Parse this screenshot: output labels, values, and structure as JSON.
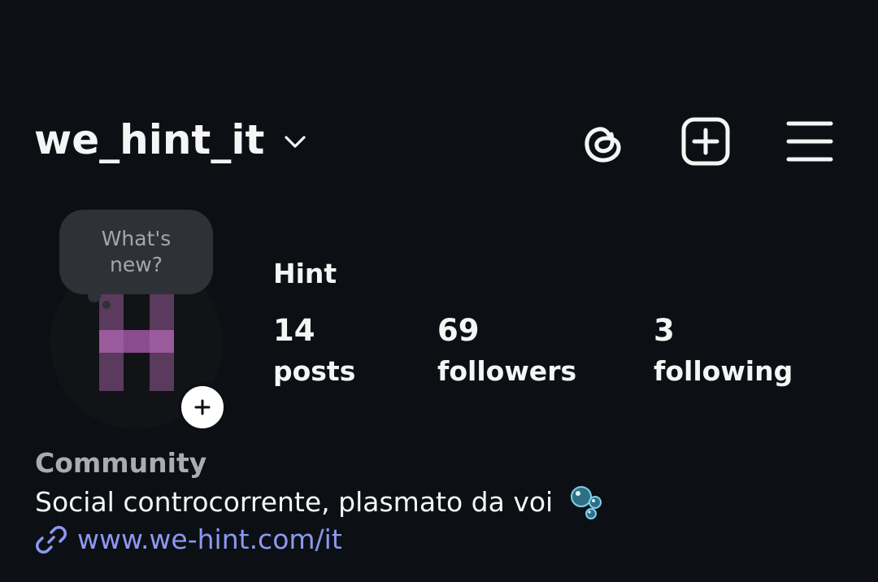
{
  "header": {
    "username": "we_hint_it",
    "icons": [
      "threads-icon",
      "create-post-icon",
      "menu-icon"
    ]
  },
  "profile": {
    "note_bubble": "What's new?",
    "display_name": "Hint",
    "avatar_letter": "H",
    "stats": [
      {
        "value": "14",
        "label": "posts"
      },
      {
        "value": "69",
        "label": "followers"
      },
      {
        "value": "3",
        "label": "following"
      }
    ],
    "category": "Community",
    "bio": "Social controcorrente, plasmato da voi",
    "bio_emoji": "bubbles-emoji",
    "link": "www.we-hint.com/it"
  },
  "colors": {
    "background": "#0c1014",
    "text": "#f5f5f5",
    "secondary_text": "#a8adb3",
    "link": "#8c98f0",
    "bubble": "#2e3136",
    "avatar_accent": "#8a4c8c"
  }
}
